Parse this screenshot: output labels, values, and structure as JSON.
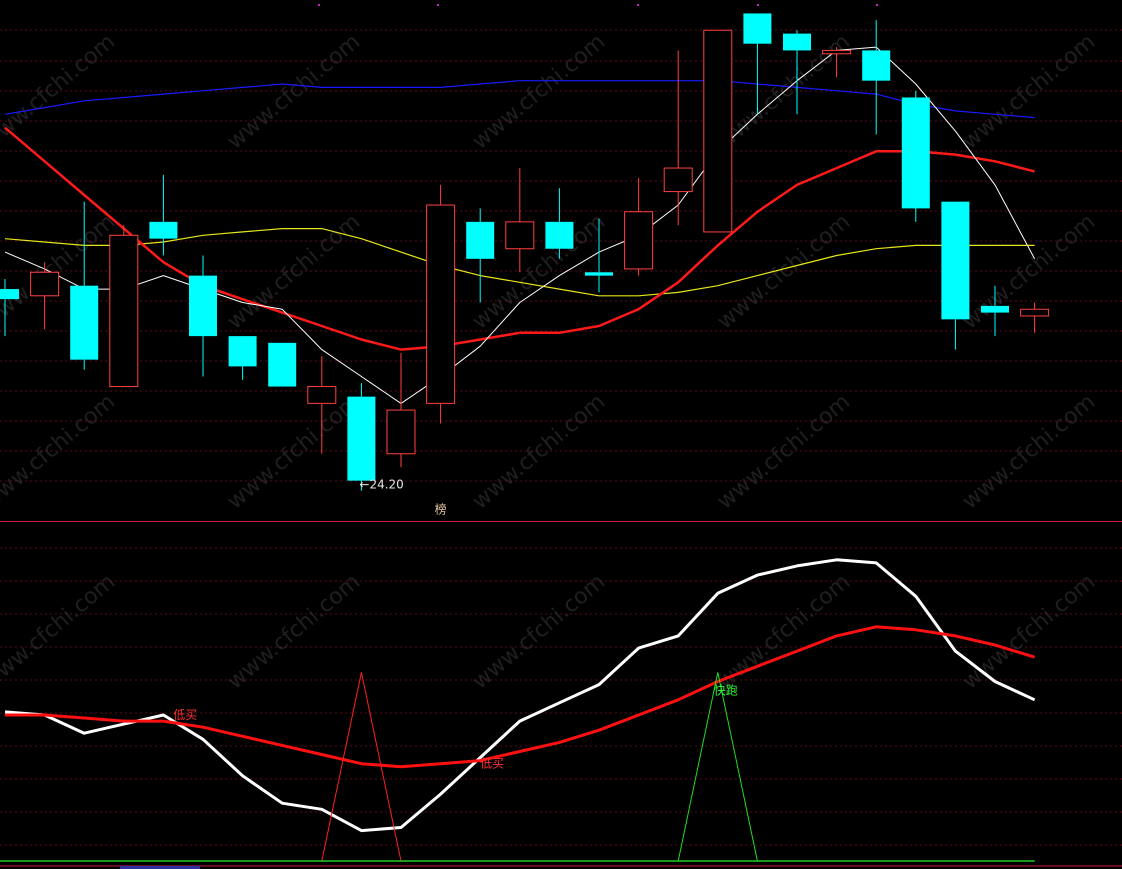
{
  "chart_data": [
    {
      "type": "candlestick",
      "ylim": [
        23.3,
        38.8
      ],
      "grid": true,
      "colors": {
        "up": "#ff4040",
        "down": "#00ffff",
        "ma_short": "#ffffff",
        "ma_mid": "#ff1a1a",
        "ma_long": "#e6e619",
        "ma_longest": "#1a1aff"
      },
      "candles": [
        {
          "o": 30.2,
          "h": 30.5,
          "l": 28.8,
          "c": 29.9
        },
        {
          "o": 30.0,
          "h": 31.0,
          "l": 29.0,
          "c": 30.7
        },
        {
          "o": 30.3,
          "h": 32.8,
          "l": 27.8,
          "c": 28.1
        },
        {
          "o": 27.3,
          "h": 32.1,
          "l": 27.3,
          "c": 31.8
        },
        {
          "o": 32.2,
          "h": 33.6,
          "l": 31.2,
          "c": 31.7
        },
        {
          "o": 30.6,
          "h": 31.2,
          "l": 27.6,
          "c": 28.8
        },
        {
          "o": 28.8,
          "h": 28.8,
          "l": 27.5,
          "c": 27.9
        },
        {
          "o": 28.6,
          "h": 28.6,
          "l": 27.3,
          "c": 27.3
        },
        {
          "o": 26.8,
          "h": 28.2,
          "l": 25.3,
          "c": 27.3
        },
        {
          "o": 27.0,
          "h": 27.4,
          "l": 24.2,
          "c": 24.5
        },
        {
          "o": 25.3,
          "h": 28.3,
          "l": 24.9,
          "c": 26.6
        },
        {
          "o": 26.8,
          "h": 33.3,
          "l": 26.2,
          "c": 32.7
        },
        {
          "o": 32.2,
          "h": 32.6,
          "l": 29.8,
          "c": 31.1
        },
        {
          "o": 31.4,
          "h": 33.8,
          "l": 30.7,
          "c": 32.2
        },
        {
          "o": 32.2,
          "h": 33.2,
          "l": 31.1,
          "c": 31.4
        },
        {
          "o": 30.7,
          "h": 32.3,
          "l": 30.1,
          "c": 30.6
        },
        {
          "o": 30.8,
          "h": 33.5,
          "l": 30.6,
          "c": 32.5
        },
        {
          "o": 33.1,
          "h": 37.3,
          "l": 32.1,
          "c": 33.8
        },
        {
          "o": 31.9,
          "h": 37.9,
          "l": 31.9,
          "c": 37.9
        },
        {
          "o": 38.4,
          "h": 38.4,
          "l": 35.4,
          "c": 37.5
        },
        {
          "o": 37.8,
          "h": 37.9,
          "l": 35.4,
          "c": 37.3
        },
        {
          "o": 37.2,
          "h": 37.4,
          "l": 36.5,
          "c": 37.3
        },
        {
          "o": 37.3,
          "h": 38.2,
          "l": 34.8,
          "c": 36.4
        },
        {
          "o": 35.9,
          "h": 36.1,
          "l": 32.2,
          "c": 32.6
        },
        {
          "o": 32.8,
          "h": 32.8,
          "l": 28.4,
          "c": 29.3
        },
        {
          "o": 29.7,
          "h": 30.3,
          "l": 28.8,
          "c": 29.5
        },
        {
          "o": 29.4,
          "h": 29.8,
          "l": 28.9,
          "c": 29.6
        }
      ],
      "ma_short": [
        31.3,
        30.8,
        30.2,
        30.2,
        30.6,
        30.2,
        29.8,
        29.6,
        28.4,
        27.6,
        26.8,
        27.6,
        28.5,
        29.8,
        30.6,
        31.3,
        31.8,
        32.7,
        34.3,
        35.4,
        36.4,
        37.3,
        37.4,
        36.3,
        34.9,
        33.3,
        31.1
      ],
      "ma_mid": [
        35.0,
        34.0,
        33.0,
        32.0,
        31.0,
        30.3,
        29.9,
        29.5,
        29.1,
        28.7,
        28.4,
        28.5,
        28.7,
        28.9,
        28.9,
        29.1,
        29.6,
        30.4,
        31.5,
        32.5,
        33.3,
        33.8,
        34.3,
        34.3,
        34.2,
        34.0,
        33.7
      ],
      "ma_long": [
        31.7,
        31.6,
        31.5,
        31.5,
        31.6,
        31.8,
        31.9,
        32.0,
        32.0,
        31.7,
        31.3,
        30.9,
        30.6,
        30.4,
        30.2,
        30.0,
        30.0,
        30.1,
        30.3,
        30.6,
        30.9,
        31.2,
        31.4,
        31.5,
        31.5,
        31.5,
        31.5
      ],
      "ma_longest": [
        35.4,
        35.6,
        35.8,
        35.9,
        36.0,
        36.1,
        36.2,
        36.3,
        36.2,
        36.2,
        36.2,
        36.2,
        36.3,
        36.4,
        36.4,
        36.4,
        36.4,
        36.4,
        36.4,
        36.3,
        36.2,
        36.1,
        36.0,
        35.7,
        35.5,
        35.4,
        35.3
      ],
      "annotations": [
        {
          "candle": 9,
          "price": 24.2,
          "text": "←24.20",
          "color": "#e6e6e6"
        },
        {
          "candle": 10.9,
          "price": 23.47,
          "text": "榜",
          "color": "#e6c8a0"
        }
      ]
    },
    {
      "type": "line",
      "ylim": [
        0,
        100
      ],
      "grid": true,
      "series": [
        {
          "key": "fast",
          "color": "#ffffff",
          "width": 3,
          "values": [
            49,
            48,
            42,
            45,
            48,
            40,
            28,
            19,
            17,
            10,
            11,
            22,
            34,
            46,
            52,
            58,
            70,
            74,
            88,
            94,
            97,
            99,
            98,
            87,
            69,
            59,
            53
          ]
        },
        {
          "key": "slow",
          "color": "#ff1010",
          "width": 3,
          "values": [
            48,
            48,
            47,
            46,
            46,
            44,
            41,
            38,
            35,
            32,
            31,
            32,
            33,
            36,
            39,
            43,
            48,
            53,
            59,
            64,
            69,
            74,
            77,
            76,
            74,
            71,
            67
          ]
        },
        {
          "key": "signal_buy",
          "color": "#ff2020",
          "width": 1,
          "values": [
            0,
            0,
            0,
            0,
            0,
            0,
            0,
            0,
            0,
            62,
            0,
            0,
            0,
            0,
            0,
            0,
            0,
            0,
            0,
            0,
            0,
            0,
            0,
            0,
            0,
            0,
            0
          ]
        },
        {
          "key": "signal_run",
          "color": "#20dd20",
          "width": 1,
          "values": [
            0,
            0,
            0,
            0,
            0,
            0,
            0,
            0,
            0,
            0,
            0,
            0,
            0,
            0,
            0,
            0,
            0,
            0,
            62,
            0,
            0,
            0,
            0,
            0,
            0,
            0,
            0
          ]
        }
      ],
      "baseline_color": "#22cc22",
      "labels": [
        {
          "text": "低买",
          "x": 4.45,
          "y": 48,
          "color": "#ff3030"
        },
        {
          "text": "低买",
          "x": 12.2,
          "y": 32,
          "color": "#ff3030"
        },
        {
          "text": "快跑",
          "x": 18.1,
          "y": 56,
          "color": "#30ff30"
        }
      ]
    }
  ],
  "watermark": {
    "text": "www.cfchi.com",
    "color": "#3a3a3a"
  }
}
